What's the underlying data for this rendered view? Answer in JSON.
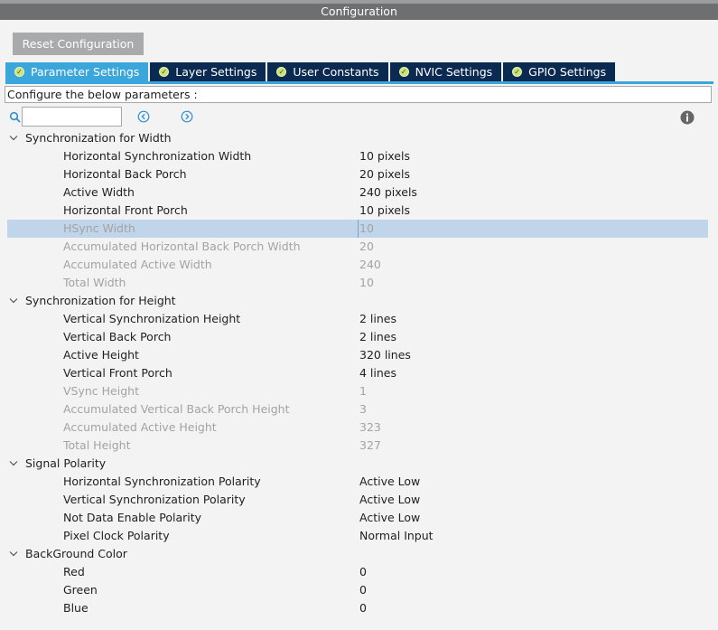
{
  "window": {
    "title": "Configuration"
  },
  "toolbar": {
    "reset_label": "Reset Configuration"
  },
  "tabs": [
    {
      "label": "Parameter Settings",
      "active": true
    },
    {
      "label": "Layer Settings",
      "active": false
    },
    {
      "label": "User Constants",
      "active": false
    },
    {
      "label": "NVIC Settings",
      "active": false
    },
    {
      "label": "GPIO Settings",
      "active": false
    }
  ],
  "info_bar": {
    "text": "Configure the below parameters :"
  },
  "search": {
    "value": "",
    "placeholder": ""
  },
  "icons": {
    "search": "search-icon",
    "prev": "circle-arrow-left-icon",
    "next": "circle-arrow-right-icon",
    "info": "info-icon",
    "tab_status": "check-circle-icon",
    "group_toggle": "chevron-down-icon"
  },
  "colors": {
    "title_bar": "#6d6f71",
    "tab_active": "#3aa6dc",
    "tab_inactive": "#0a2a52",
    "tab_check": "#cbe27a",
    "selected_row": "#c0d4ea",
    "disabled_text": "#a3a3a3"
  },
  "groups": [
    {
      "label": "Synchronization for Width",
      "params": [
        {
          "name": "Horizontal Synchronization Width",
          "value": "10 pixels",
          "disabled": false
        },
        {
          "name": "Horizontal Back Porch",
          "value": "20 pixels",
          "disabled": false
        },
        {
          "name": "Active Width",
          "value": "240 pixels",
          "disabled": false
        },
        {
          "name": "Horizontal Front Porch",
          "value": "10 pixels",
          "disabled": false
        },
        {
          "name": "HSync Width",
          "value": "10",
          "disabled": true,
          "selected": true
        },
        {
          "name": "Accumulated Horizontal Back Porch Width",
          "value": "20",
          "disabled": true
        },
        {
          "name": "Accumulated Active Width",
          "value": "240",
          "disabled": true
        },
        {
          "name": "Total Width",
          "value": "10",
          "disabled": true
        }
      ]
    },
    {
      "label": "Synchronization for Height",
      "params": [
        {
          "name": "Vertical Synchronization Height",
          "value": "2 lines",
          "disabled": false
        },
        {
          "name": "Vertical Back Porch",
          "value": "2 lines",
          "disabled": false
        },
        {
          "name": "Active Height",
          "value": "320 lines",
          "disabled": false
        },
        {
          "name": "Vertical Front Porch",
          "value": "4 lines",
          "disabled": false
        },
        {
          "name": "VSync Height",
          "value": "1",
          "disabled": true
        },
        {
          "name": "Accumulated Vertical Back Porch Height",
          "value": "3",
          "disabled": true
        },
        {
          "name": "Accumulated Active Height",
          "value": "323",
          "disabled": true
        },
        {
          "name": "Total Height",
          "value": "327",
          "disabled": true
        }
      ]
    },
    {
      "label": "Signal Polarity",
      "params": [
        {
          "name": "Horizontal Synchronization Polarity",
          "value": "Active Low",
          "disabled": false
        },
        {
          "name": "Vertical Synchronization Polarity",
          "value": "Active Low",
          "disabled": false
        },
        {
          "name": "Not Data Enable Polarity",
          "value": "Active Low",
          "disabled": false
        },
        {
          "name": "Pixel Clock Polarity",
          "value": "Normal Input",
          "disabled": false
        }
      ]
    },
    {
      "label": "BackGround Color",
      "params": [
        {
          "name": "Red",
          "value": "0",
          "disabled": false
        },
        {
          "name": "Green",
          "value": "0",
          "disabled": false
        },
        {
          "name": "Blue",
          "value": "0",
          "disabled": false
        }
      ]
    }
  ]
}
